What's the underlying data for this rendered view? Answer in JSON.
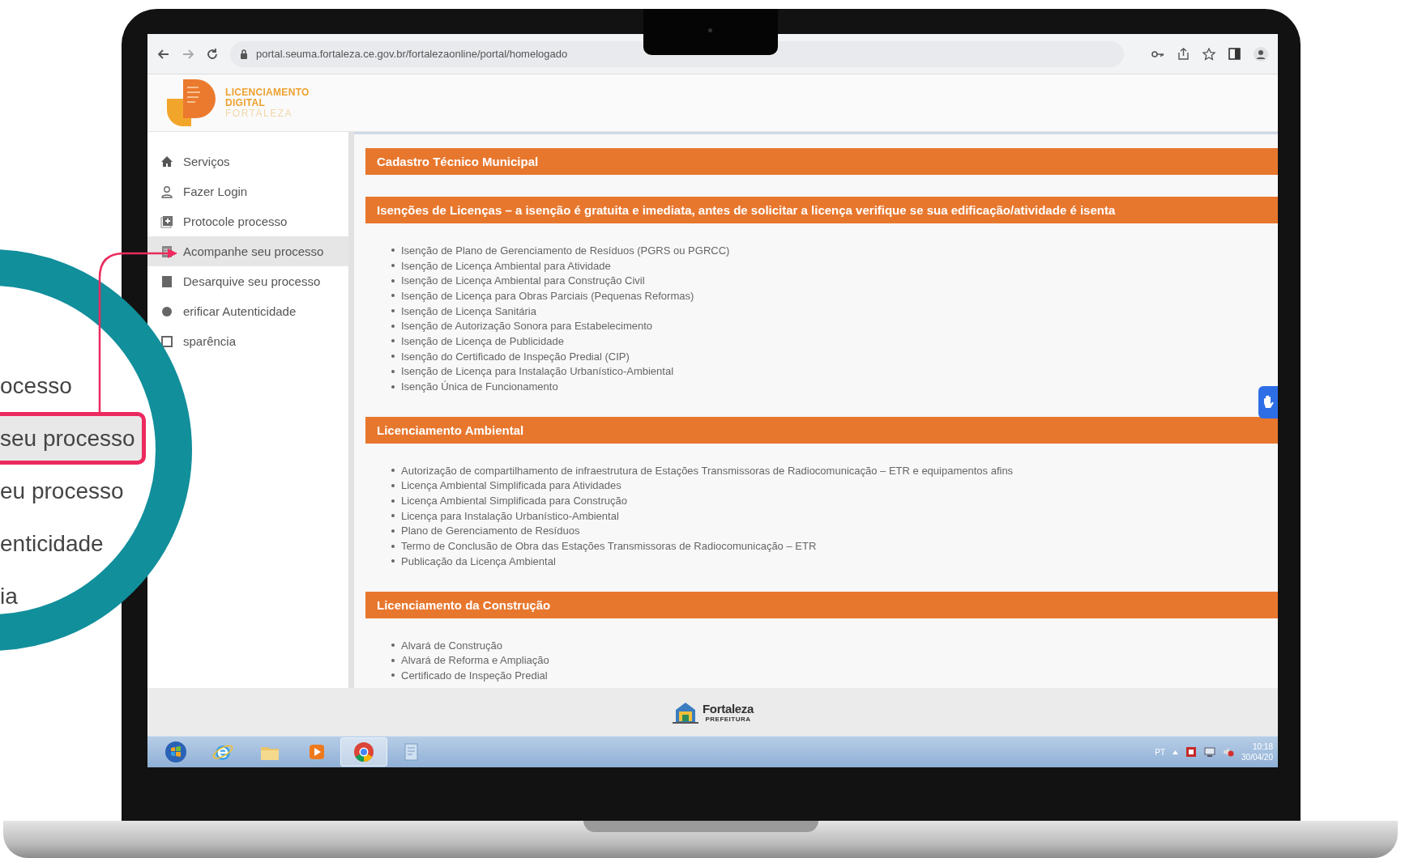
{
  "browser": {
    "url": "portal.seuma.fortaleza.ce.gov.br/fortalezaonline/portal/homelogado"
  },
  "logo": {
    "lines": [
      "LICENCIAMENTO",
      "DIGITAL",
      "FORTALEZA"
    ]
  },
  "sidebar": {
    "items": [
      {
        "label": "Serviços",
        "selected": false
      },
      {
        "label": "Fazer Login",
        "selected": false
      },
      {
        "label": "Protocole processo",
        "selected": false
      },
      {
        "label": "Acompanhe seu processo",
        "selected": true
      },
      {
        "label": "Desarquive seu processo",
        "selected": false
      },
      {
        "label": "erificar Autenticidade",
        "selected": false
      },
      {
        "label": "sparência",
        "selected": false
      }
    ]
  },
  "sections": [
    {
      "title": "Cadastro Técnico Municipal"
    },
    {
      "title": "Isenções de Licenças – a isenção é gratuita e imediata, antes de solicitar a licença verifique se sua edificação/atividade é isenta",
      "items": [
        "Isenção de Plano de Gerenciamento de Resíduos (PGRS ou PGRCC)",
        "Isenção de Licença Ambiental para Atividade",
        "Isenção de Licença Ambiental para Construção Civil",
        "Isenção de Licença para Obras Parciais (Pequenas Reformas)",
        "Isenção de Licença Sanitária",
        "Isenção de Autorização Sonora para Estabelecimento",
        "Isenção de Licença de Publicidade",
        "Isenção do Certificado de Inspeção Predial (CIP)",
        "Isenção de Licença para Instalação Urbanístico-Ambiental",
        "Isenção Única de Funcionamento"
      ]
    },
    {
      "title": "Licenciamento Ambiental",
      "items": [
        "Autorização de compartilhamento de infraestrutura de Estações Transmissoras de Radiocomunicação – ETR e equipamentos afins",
        "Licença Ambiental Simplificada para Atividades",
        "Licença Ambiental Simplificada para Construção",
        "Licença para Instalação Urbanístico-Ambiental",
        "Plano de Gerenciamento de Resíduos",
        "Termo de Conclusão de Obra das Estações Transmissoras de Radiocomunicação – ETR",
        "Publicação da Licença Ambiental"
      ]
    },
    {
      "title": "Licenciamento da Construção",
      "items": [
        "Alvará de Construção",
        "Alvará de Reforma e Ampliação",
        "Certificado de Inspeção Predial"
      ]
    }
  ],
  "footer": {
    "name": "Fortaleza",
    "subtitle": "PREFEITURA"
  },
  "taskbar": {
    "apps": [
      {
        "selected": false
      },
      {
        "selected": false
      },
      {
        "selected": false
      },
      {
        "selected": false
      },
      {
        "selected": true
      },
      {
        "selected": false
      }
    ],
    "language": "PT",
    "time": "10:18",
    "date": "30/04/20"
  },
  "magnifier": {
    "items": [
      {
        "label": "ocesso",
        "selected": false
      },
      {
        "label": "seu processo",
        "selected": true
      },
      {
        "label": "eu processo",
        "selected": false
      },
      {
        "label": "enticidade",
        "selected": false
      },
      {
        "label": "ia",
        "selected": false
      }
    ]
  }
}
